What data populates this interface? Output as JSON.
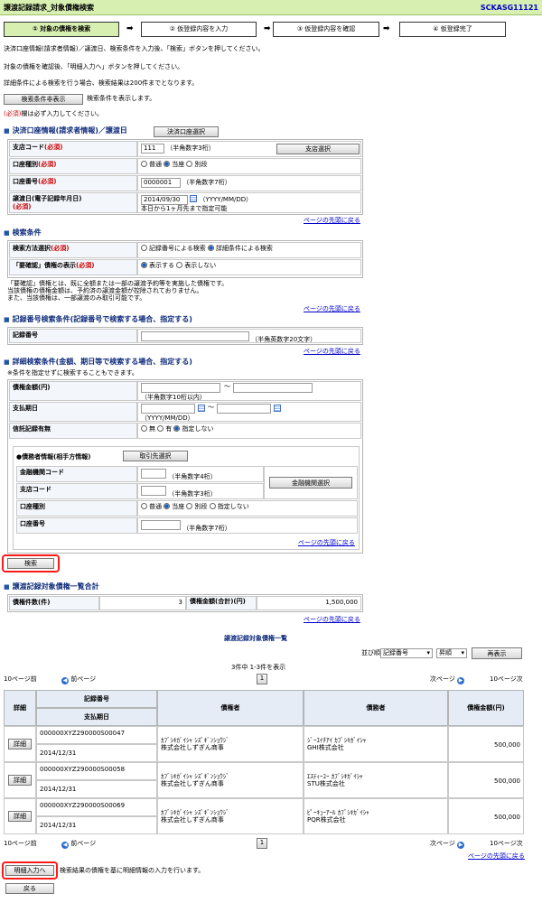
{
  "header": {
    "title": "譲渡記録請求_対象債権検索",
    "screen_id": "SCKASG11121"
  },
  "steps": [
    {
      "label": "① 対象の債権を検索"
    },
    {
      "label": "② 仮登録内容を入力"
    },
    {
      "label": "③ 仮登録内容を確認"
    },
    {
      "label": "④ 仮登録完了"
    }
  ],
  "arrow": "➡",
  "intro": [
    "決済口座情報(請求者情報)／譲渡日、検索条件を入力後、「検索」ボタンを押してください。",
    "対象の債権を確認後、「明細入力へ」ボタンを押してください。",
    "詳細条件による検索を行う場合、検索結果は200件までとなります。"
  ],
  "toggle": {
    "button": "検索条件非表示",
    "note": "検索条件を表示します。"
  },
  "req_note": {
    "mark": "(必須)",
    "text": "欄は必ず入力してください。"
  },
  "sec1": {
    "title": "決済口座情報(請求者情報)／譲渡日",
    "select_btn": "決済口座選択",
    "rows": [
      {
        "label": "支店コード",
        "req": "(必須)",
        "value": "111",
        "hint": "（半角数字3桁）",
        "btn": "支店選択"
      },
      {
        "label": "口座種別",
        "req": "(必須)",
        "options": [
          "普通",
          "当座",
          "別段"
        ]
      },
      {
        "label": "口座番号",
        "req": "(必須)",
        "value": "0000001",
        "hint": "（半角数字7桁）"
      },
      {
        "label": "譲渡日(電子記録年月日)",
        "req": "(必須)",
        "value": "2014/09/30",
        "hint": "（YYYY/MM/DD）",
        "note": "本日から1ヶ月先まで指定可能"
      }
    ]
  },
  "top_link": "ページの先頭に戻る",
  "sec2": {
    "title": "検索条件",
    "rows": [
      {
        "label": "検索方法選択",
        "req": "(必須)",
        "options": [
          "記録番号による検索",
          "詳細条件による検索"
        ]
      },
      {
        "label": "「要確認」債権の表示",
        "req": "(必須)",
        "options": [
          "表示する",
          "表示しない"
        ]
      }
    ],
    "note": [
      "「要確認」債権とは、既に全額または一部の譲渡予約等を実施した債権です。",
      "当該債権の債権金額は、予約済の譲渡金額が控除されておりません。",
      "また、当該債権は、一部譲渡のみ取引可能です。"
    ]
  },
  "sec3": {
    "title": "記録番号検索条件(記録番号で検索する場合、指定する)",
    "label": "記録番号",
    "hint": "（半角英数字20文字）"
  },
  "sec4": {
    "title": "詳細検索条件(金額、期日等で検索する場合、指定する)",
    "note": "※条件を指定せずに検索することもできます。",
    "amount": {
      "label": "債権金額(円)",
      "hint": "（半角数字10桁以内）",
      "tilde": "～"
    },
    "due": {
      "label": "支払期日",
      "hint": "（YYYY/MM/DD）",
      "tilde": "～"
    },
    "trust": {
      "label": "信託記録有無",
      "options": [
        "無",
        "有",
        "指定しない"
      ]
    },
    "debtor": {
      "title": "●債務者情報(相手方情報)",
      "btn": "取引先選択",
      "rows": [
        {
          "label": "金融機関コード",
          "hint": "（半角数字4桁）"
        },
        {
          "label": "支店コード",
          "hint": "（半角数字3桁）"
        },
        {
          "label": "口座種別",
          "options": [
            "普通",
            "当座",
            "別段",
            "指定しない"
          ]
        },
        {
          "label": "口座番号",
          "hint": "（半角数字7桁）"
        }
      ],
      "bank_btn": "金融機関選択"
    }
  },
  "search_btn": "検索",
  "sec5": {
    "title": "譲渡記録対象債権一覧合計",
    "count_label": "債権件数(件)",
    "count": "3",
    "amount_label": "債権金額(合計)(円)",
    "amount": "1,500,000"
  },
  "list": {
    "title": "譲渡記録対象債権一覧",
    "sort_label": "並び順:",
    "sort_value": "記録番号",
    "order_value": "昇順",
    "redisplay": "再表示",
    "count_text": "3件中 1-3件を表示",
    "prev10": "10ページ前",
    "prev": "前ページ",
    "page": "1",
    "next": "次ページ",
    "next10": "10ページ次",
    "headers": {
      "detail": "詳細",
      "record_no": "記録番号",
      "due": "支払期日",
      "creditor": "債権者",
      "debtor": "債務者",
      "amount": "債権金額(円)"
    },
    "detail_btn": "詳細",
    "rows": [
      {
        "record_no": "000000XYZ290000S00047",
        "due": "2014/12/31",
        "creditor_kana": "ｶﾌﾞｼｷｶﾞｲｼｬ ｼｽﾞｷﾞﾝｼｮｳｼﾞ",
        "creditor": "株式会社しずぎん商事",
        "debtor_kana": "ｼﾞｰｴｲﾁｱｲ ｶﾌﾞｼｷｶﾞｲｼｬ",
        "debtor": "GHI株式会社",
        "amount": "500,000"
      },
      {
        "record_no": "000000XYZ290000S00058",
        "due": "2014/12/31",
        "creditor_kana": "ｶﾌﾞｼｷｶﾞｲｼｬ ｼｽﾞｷﾞﾝｼｮｳｼﾞ",
        "creditor": "株式会社しずぎん商事",
        "debtor_kana": "ｴｽﾃｨｰﾕｰ ｶﾌﾞｼｷｶﾞｲｼｬ",
        "debtor": "STU株式会社",
        "amount": "500,000"
      },
      {
        "record_no": "000000XYZ290000S00069",
        "due": "2014/12/31",
        "creditor_kana": "ｶﾌﾞｼｷｶﾞｲｼｬ ｼｽﾞｷﾞﾝｼｮｳｼﾞ",
        "creditor": "株式会社しずぎん商事",
        "debtor_kana": "ﾋﾟｰｷｭｰｱｰﾙ ｶﾌﾞｼｷｶﾞｲｼｬ",
        "debtor": "PQR株式会社",
        "amount": "500,000"
      }
    ]
  },
  "footer": {
    "detail_input_btn": "明細入力へ",
    "detail_input_note": "検索結果の債権を基に明細情報の入力を行います。",
    "back_btn": "戻る"
  }
}
